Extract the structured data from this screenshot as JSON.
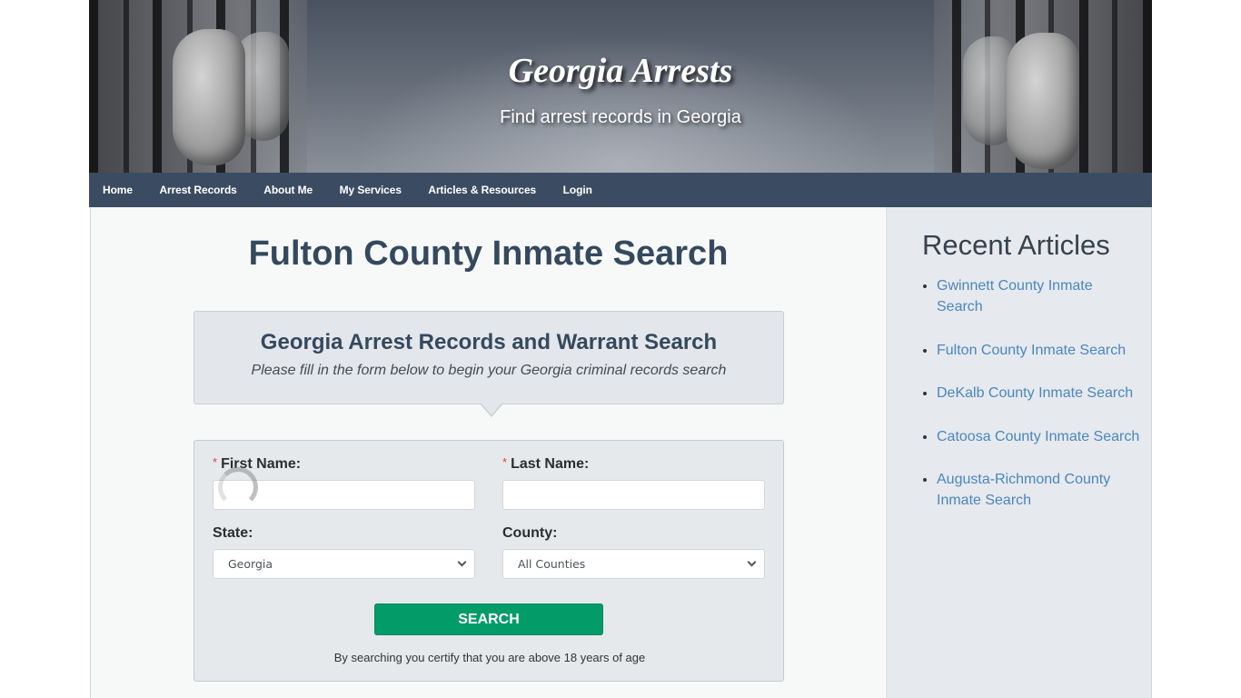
{
  "header": {
    "site_title": "Georgia Arrests",
    "tagline": "Find arrest records in Georgia"
  },
  "nav": {
    "items": [
      {
        "label": "Home"
      },
      {
        "label": "Arrest Records"
      },
      {
        "label": "About Me"
      },
      {
        "label": "My Services"
      },
      {
        "label": "Articles & Resources"
      },
      {
        "label": "Login"
      }
    ]
  },
  "main": {
    "page_title": "Fulton County Inmate Search",
    "info_box": {
      "heading": "Georgia Arrest Records and Warrant Search",
      "subtext": "Please fill in the form below to begin your Georgia criminal records search"
    },
    "form": {
      "required_marker": "*",
      "first_name": {
        "label": "First Name:",
        "value": "",
        "required": true
      },
      "last_name": {
        "label": "Last Name:",
        "value": "",
        "required": true
      },
      "state": {
        "label": "State:",
        "selected": "Georgia"
      },
      "county": {
        "label": "County:",
        "selected": "All Counties"
      },
      "search_button": "SEARCH",
      "disclaimer": "By searching you certify that you are above 18 years of age"
    }
  },
  "sidebar": {
    "heading": "Recent Articles",
    "articles": [
      {
        "label": "Gwinnett County Inmate Search"
      },
      {
        "label": "Fulton County Inmate Search"
      },
      {
        "label": "DeKalb County Inmate Search"
      },
      {
        "label": "Catoosa County Inmate Search"
      },
      {
        "label": "Augusta-Richmond County Inmate Search"
      }
    ]
  },
  "colors": {
    "nav_bg": "#2c3e56",
    "title_text": "#34495e",
    "search_button": "#039b67",
    "link": "#4a86c0",
    "required": "#e23a3a"
  }
}
